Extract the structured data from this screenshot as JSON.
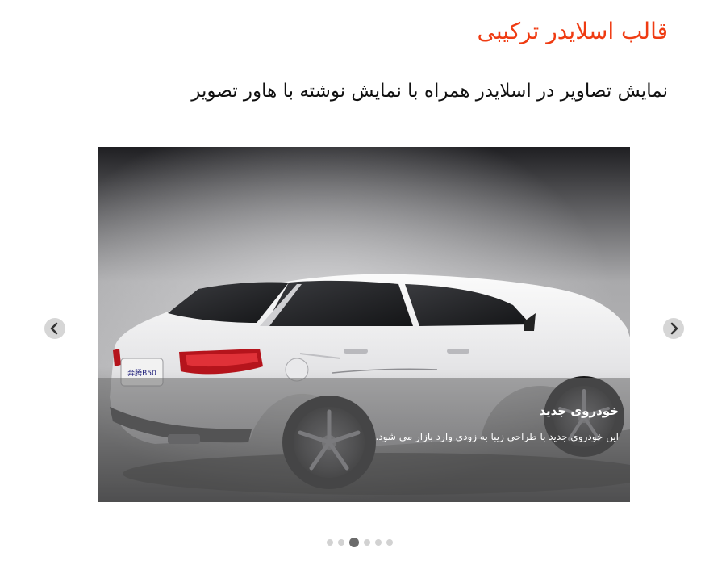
{
  "header": {
    "title": "قالب اسلایدر ترکیبی",
    "subtitle": "نمایش تصاویر در اسلایدر همراه با نمایش نوشته با هاور تصویر"
  },
  "slider": {
    "slide": {
      "image_label": "white sedan car",
      "plate_text": "奔腾B50",
      "caption_title": "خودروی جدید",
      "caption_text": "این خودروی جدید با طراحی زیبا به زودی وارد بازار می شود."
    },
    "prev_icon": "chevron-left-icon",
    "next_icon": "chevron-right-icon",
    "pagination": {
      "count": 6,
      "active_index": 2
    }
  },
  "colors": {
    "title": "#ef3b12",
    "subtitle": "#111111",
    "caption_overlay": "#6e6e6e",
    "nav_button": "#d6d6d6",
    "dot": "#d2d2d2",
    "dot_active": "#6b6b6b"
  }
}
